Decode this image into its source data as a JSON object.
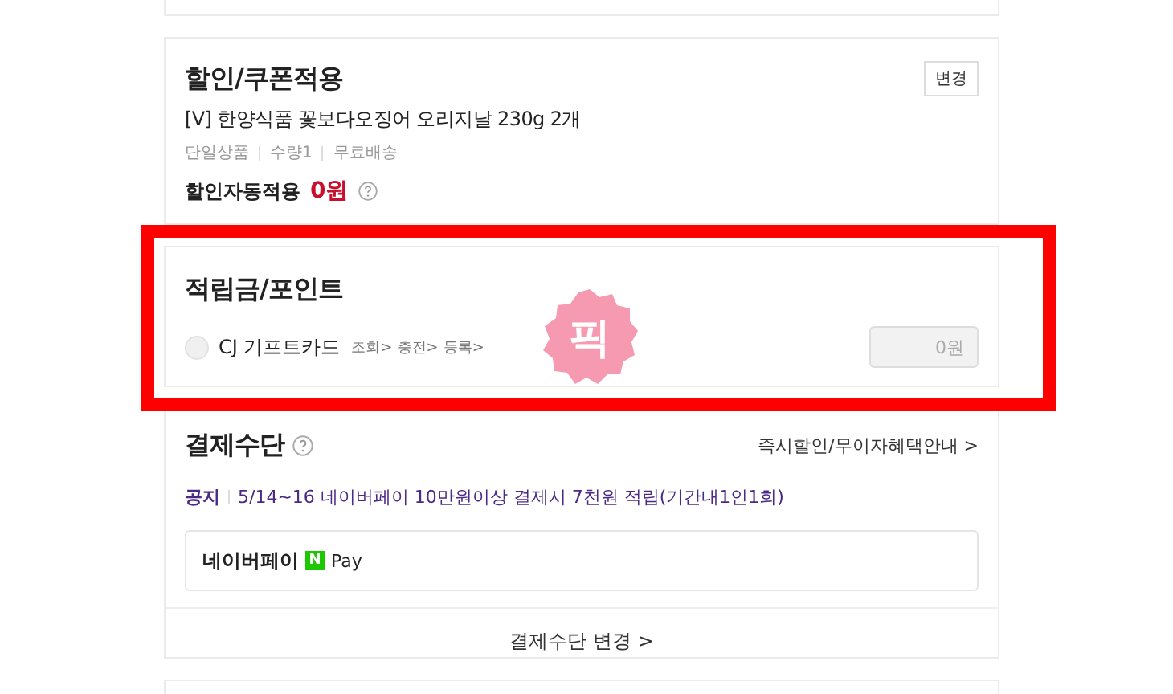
{
  "discount": {
    "title": "할인/쿠폰적용",
    "change_button": "변경",
    "product": "[V] 한양식품 꽃보다오징어 오리지날 230g 2개",
    "meta": [
      "단일상품",
      "수량1",
      "무료배송"
    ],
    "auto_label": "할인자동적용",
    "auto_amount": "0원"
  },
  "points": {
    "title": "적립금/포인트",
    "option": {
      "label": "CJ 기프트카드",
      "checked": false
    },
    "links": [
      "조회>",
      "충전>",
      "등록>"
    ],
    "amount": "0원"
  },
  "sticker": "픽",
  "payment": {
    "title": "결제수단",
    "benefit_link": "즉시할인/무이자혜택안내 >",
    "notice_label": "공지",
    "notice": "5/14~16 네이버페이 10만원이상 결제시 7천원 적립(기간내1인1회)",
    "method": {
      "name": "네이버페이",
      "logo_letter": "N",
      "logo_text": "Pay"
    },
    "change_link": "결제수단 변경 >"
  }
}
